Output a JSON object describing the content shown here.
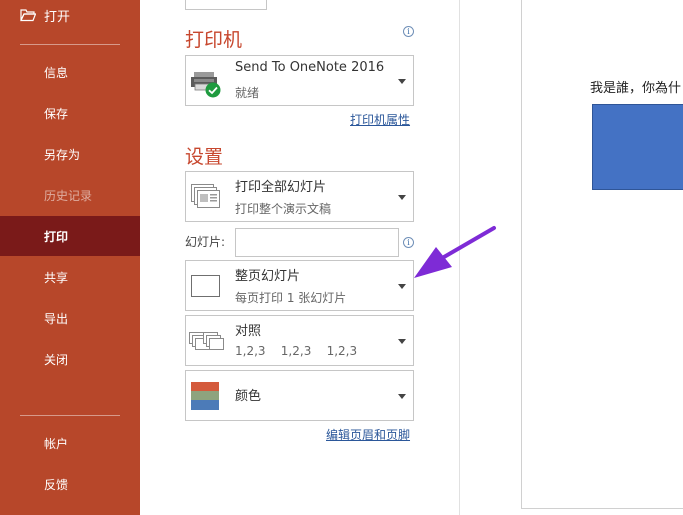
{
  "sidebar": {
    "open": "打开",
    "items": [
      {
        "label": "信息",
        "state": "normal"
      },
      {
        "label": "保存",
        "state": "normal"
      },
      {
        "label": "另存为",
        "state": "normal"
      },
      {
        "label": "历史记录",
        "state": "disabled"
      },
      {
        "label": "打印",
        "state": "active"
      },
      {
        "label": "共享",
        "state": "normal"
      },
      {
        "label": "导出",
        "state": "normal"
      },
      {
        "label": "关闭",
        "state": "normal"
      }
    ],
    "bottom_items": [
      {
        "label": "帐户"
      },
      {
        "label": "反馈"
      }
    ]
  },
  "printer": {
    "title": "打印机",
    "name": "Send To OneNote 2016",
    "status": "就绪",
    "properties_link": "打印机属性"
  },
  "settings": {
    "title": "设置",
    "range": {
      "line1": "打印全部幻灯片",
      "line2": "打印整个演示文稿"
    },
    "slides_label": "幻灯片:",
    "slides_value": "",
    "layout": {
      "line1": "整页幻灯片",
      "line2": "每页打印 1 张幻灯片"
    },
    "collate": {
      "line1": "对照",
      "line2": "1,2,3    1,2,3    1,2,3"
    },
    "color": {
      "line1": "颜色"
    },
    "header_footer_link": "编辑页眉和页脚"
  },
  "preview": {
    "text": "我是誰，你為什"
  },
  "colors": {
    "sidebar": "#b7472a",
    "sidebar_active": "#7a1a19",
    "accent_title": "#c7472e",
    "link": "#2b579a",
    "arrow": "#7e2bd6",
    "preview_shape": "#4472c4"
  },
  "icons": [
    "folder-open-icon",
    "info-icon",
    "printer-icon",
    "ready-check-icon",
    "slides-stack-icon",
    "full-page-slide-icon",
    "collate-icon",
    "color-swatch-icon",
    "dropdown-arrow-icon"
  ]
}
